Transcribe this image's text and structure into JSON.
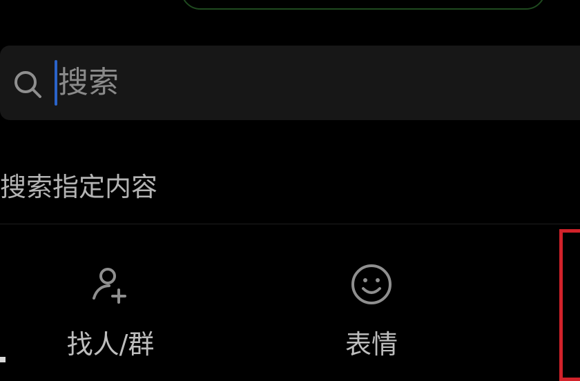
{
  "search": {
    "placeholder": "搜索"
  },
  "section": {
    "title": "搜索指定内容"
  },
  "options": [
    {
      "label": "找人/群",
      "icon": "add-user-icon"
    },
    {
      "label": "表情",
      "icon": "smiley-icon"
    }
  ],
  "colors": {
    "background": "#000000",
    "search_bar": "#171717",
    "caret": "#2a63c9",
    "highlight": "#d1222a",
    "text": "#bdbdbd",
    "top_outline": "#1f4a1f"
  }
}
